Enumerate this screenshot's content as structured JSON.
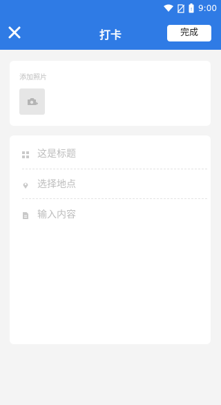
{
  "status_bar": {
    "time": "9:00",
    "icons": [
      "wifi-icon",
      "no-sim-icon",
      "battery-icon"
    ]
  },
  "app_bar": {
    "close_icon": "close-icon",
    "title": "打卡",
    "done_label": "完成"
  },
  "photos": {
    "label": "添加照片",
    "add_icon": "camera-add-icon"
  },
  "form": {
    "title_placeholder": "这是标题",
    "location_label": "选择地点",
    "content_placeholder": "输入内容"
  },
  "colors": {
    "primary": "#2f7be5",
    "background": "#f4f4f4",
    "placeholder": "#bdbdbd"
  }
}
